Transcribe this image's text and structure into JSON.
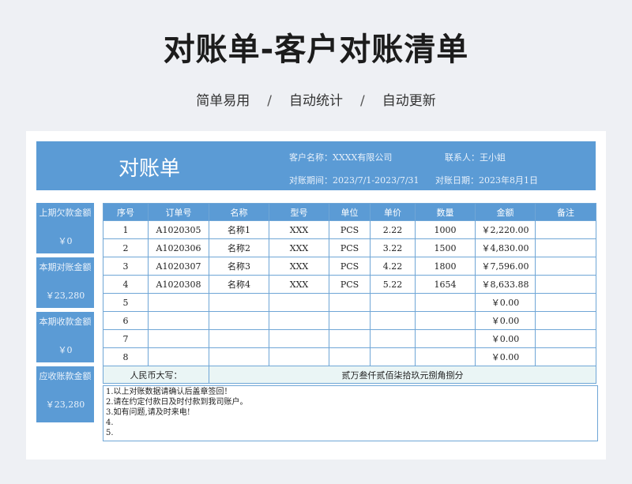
{
  "page": {
    "title": "对账单-客户对账清单",
    "subtitle": [
      "简单易用",
      "自动统计",
      "自动更新"
    ],
    "separator": "/"
  },
  "header": {
    "big_title": "对账单",
    "customer": "客户名称：XXXX有限公司",
    "contact": "联系人：王小姐",
    "period": "对账期间：2023/7/1-2023/7/31",
    "date": "对账日期：2023年8月1日"
  },
  "side": [
    {
      "label": "上期欠款金额",
      "value": "￥0"
    },
    {
      "label": "本期对账金额",
      "value": "￥23,280"
    },
    {
      "label": "本期收款金额",
      "value": "￥0"
    },
    {
      "label": "应收账款金额",
      "value": "￥23,280"
    }
  ],
  "table": {
    "columns": [
      "序号",
      "订单号",
      "名称",
      "型号",
      "单位",
      "单价",
      "数量",
      "金额",
      "备注"
    ],
    "rows": [
      [
        "1",
        "A1020305",
        "名称1",
        "XXX",
        "PCS",
        "2.22",
        "1000",
        "￥2,220.00",
        ""
      ],
      [
        "2",
        "A1020306",
        "名称2",
        "XXX",
        "PCS",
        "3.22",
        "1500",
        "￥4,830.00",
        ""
      ],
      [
        "3",
        "A1020307",
        "名称3",
        "XXX",
        "PCS",
        "4.22",
        "1800",
        "￥7,596.00",
        ""
      ],
      [
        "4",
        "A1020308",
        "名称4",
        "XXX",
        "PCS",
        "5.22",
        "1654",
        "￥8,633.88",
        ""
      ],
      [
        "5",
        "",
        "",
        "",
        "",
        "",
        "",
        "￥0.00",
        ""
      ],
      [
        "6",
        "",
        "",
        "",
        "",
        "",
        "",
        "￥0.00",
        ""
      ],
      [
        "7",
        "",
        "",
        "",
        "",
        "",
        "",
        "￥0.00",
        ""
      ],
      [
        "8",
        "",
        "",
        "",
        "",
        "",
        "",
        "￥0.00",
        ""
      ]
    ],
    "rmb_label": "人民币大写：",
    "rmb_value": "贰万叁仟贰佰柒拾玖元捌角捌分"
  },
  "notes": [
    "1.以上对账数据请确认后盖章签回！",
    "2.请在约定付款日及时付款到我司账户。",
    "3.如有问题,请及时来电!",
    "4.",
    "5."
  ],
  "colors": {
    "accent": "#5b9bd5",
    "border": "#6fa6d6",
    "rmb_row": "#eaf5f5"
  }
}
